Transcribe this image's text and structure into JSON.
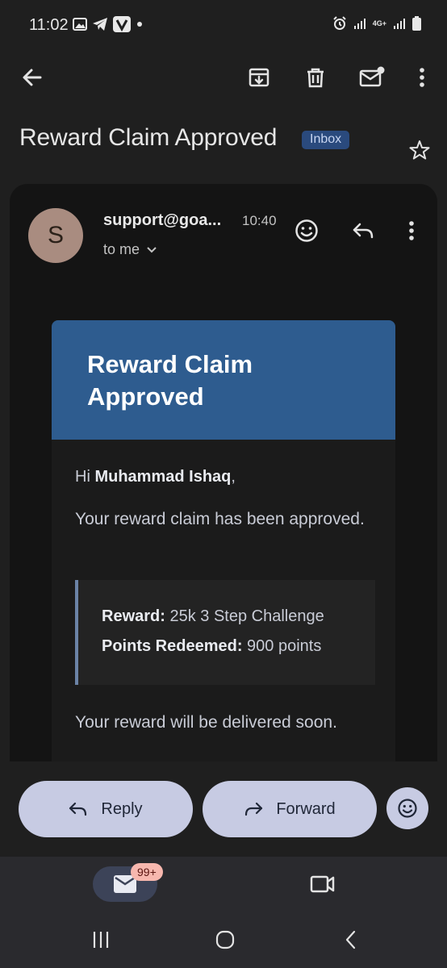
{
  "status_bar": {
    "time": "11:02",
    "network_label": "4G+"
  },
  "toolbar": {
    "back_icon": "arrow-left-icon",
    "archive_icon": "archive-icon",
    "delete_icon": "trash-icon",
    "mark_unread_icon": "mail-unread-icon",
    "more_icon": "more-vert-icon"
  },
  "subject": {
    "title": "Reward Claim Approved",
    "label": "Inbox"
  },
  "message": {
    "avatar_letter": "S",
    "sender": "support@goa...",
    "time": "10:40",
    "recipient": "to me"
  },
  "email": {
    "banner_title": "Reward Claim Approved",
    "greeting_prefix": "Hi ",
    "greeting_name": "Muhammad Ishaq",
    "greeting_suffix": ",",
    "paragraph1": "Your reward claim has been approved.",
    "details": [
      {
        "label": "Reward:",
        "value": " 25k 3 Step Challenge"
      },
      {
        "label": "Points Redeemed:",
        "value": " 900 points"
      }
    ],
    "paragraph2": "Your reward will be delivered soon."
  },
  "actions": {
    "reply_label": "Reply",
    "forward_label": "Forward"
  },
  "bottom_nav": {
    "mail_badge": "99+"
  },
  "colors": {
    "background": "#1f1f1f",
    "banner": "#2e5c8f",
    "label_chip": "#2a4a7d",
    "pill_button": "#c7cbe3",
    "badge": "#f7b7ae"
  }
}
